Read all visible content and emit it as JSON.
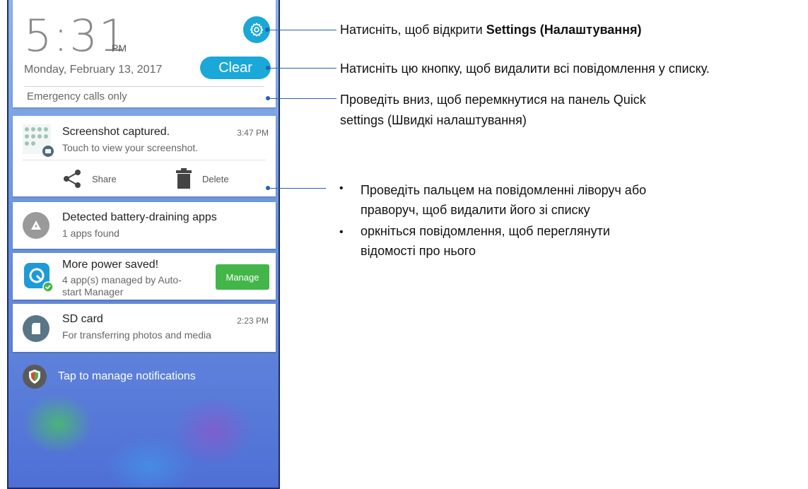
{
  "lock": {
    "time": "5:31",
    "ampm": "PM",
    "date": "Monday, February 13, 2017",
    "clear_label": "Clear",
    "emergency": "Emergency calls only"
  },
  "notifications": {
    "screenshot": {
      "title": "Screenshot captured.",
      "time": "3:47 PM",
      "text": "Touch to view your screenshot.",
      "share_label": "Share",
      "delete_label": "Delete"
    },
    "battery": {
      "title": "Detected battery-draining apps",
      "text": "1 apps found"
    },
    "power": {
      "title": "More power saved!",
      "text_line1": "4 app(s) managed by Auto-",
      "text_line2": "start Manager",
      "manage_label": "Manage"
    },
    "sdcard": {
      "title": "SD card",
      "time": "2:23 PM",
      "text": "For transferring photos and media"
    },
    "manage_link": "Tap to manage notifications"
  },
  "annotations": {
    "settings_prefix": "Натисніть, щоб відкрити ",
    "settings_bold": "Settings (Налаштування)",
    "clear": "Натисніть цю кнопку, щоб видалити всі повідомлення у списку.",
    "quick_line1": "Проведіть вниз, щоб перемкнутися на панель Quick",
    "quick_line2": "settings (Швидкі налаштування)",
    "bullet1_line1": "Проведіть пальцем на повідомленні ліворуч або",
    "bullet1_line2": "праворуч, щоб видалити його зі списку",
    "bullet2_line1": "оркніться повідомлення, щоб переглянути",
    "bullet2_line2": "відомості про нього",
    "bullet_char": "•"
  },
  "colors": {
    "accent": "#1aa8d8",
    "callout": "#2860b2",
    "manage_button": "#43b649"
  }
}
